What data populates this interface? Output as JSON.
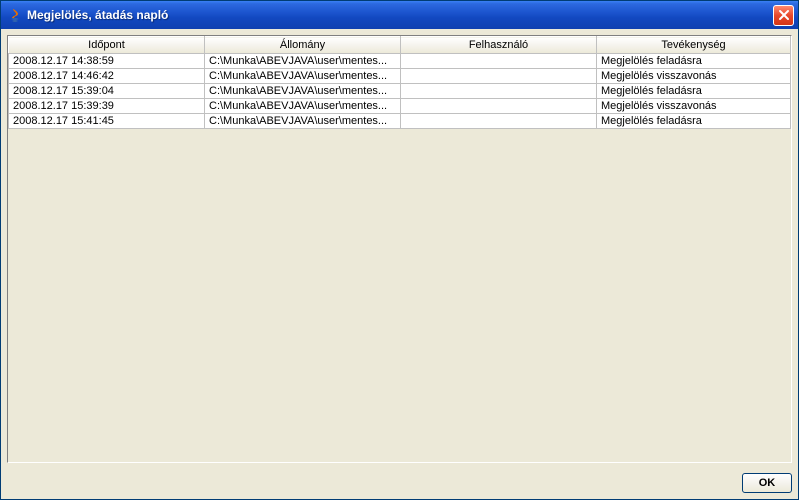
{
  "window": {
    "title": "Megjelölés, átadás napló",
    "icon": "java-icon"
  },
  "table": {
    "columns": [
      {
        "label": "Időpont"
      },
      {
        "label": "Állomány"
      },
      {
        "label": "Felhasználó"
      },
      {
        "label": "Tevékenység"
      }
    ],
    "rows": [
      {
        "time": "2008.12.17 14:38:59",
        "file": "C:\\Munka\\ABEVJAVA\\user\\mentes...",
        "user": "",
        "activity": "Megjelölés feladásra"
      },
      {
        "time": "2008.12.17 14:46:42",
        "file": "C:\\Munka\\ABEVJAVA\\user\\mentes...",
        "user": "",
        "activity": "Megjelölés visszavonás"
      },
      {
        "time": "2008.12.17 15:39:04",
        "file": "C:\\Munka\\ABEVJAVA\\user\\mentes...",
        "user": "",
        "activity": "Megjelölés feladásra"
      },
      {
        "time": "2008.12.17 15:39:39",
        "file": "C:\\Munka\\ABEVJAVA\\user\\mentes...",
        "user": "",
        "activity": "Megjelölés visszavonás"
      },
      {
        "time": "2008.12.17 15:41:45",
        "file": "C:\\Munka\\ABEVJAVA\\user\\mentes...",
        "user": "",
        "activity": "Megjelölés feladásra"
      }
    ]
  },
  "buttons": {
    "ok": "OK"
  }
}
